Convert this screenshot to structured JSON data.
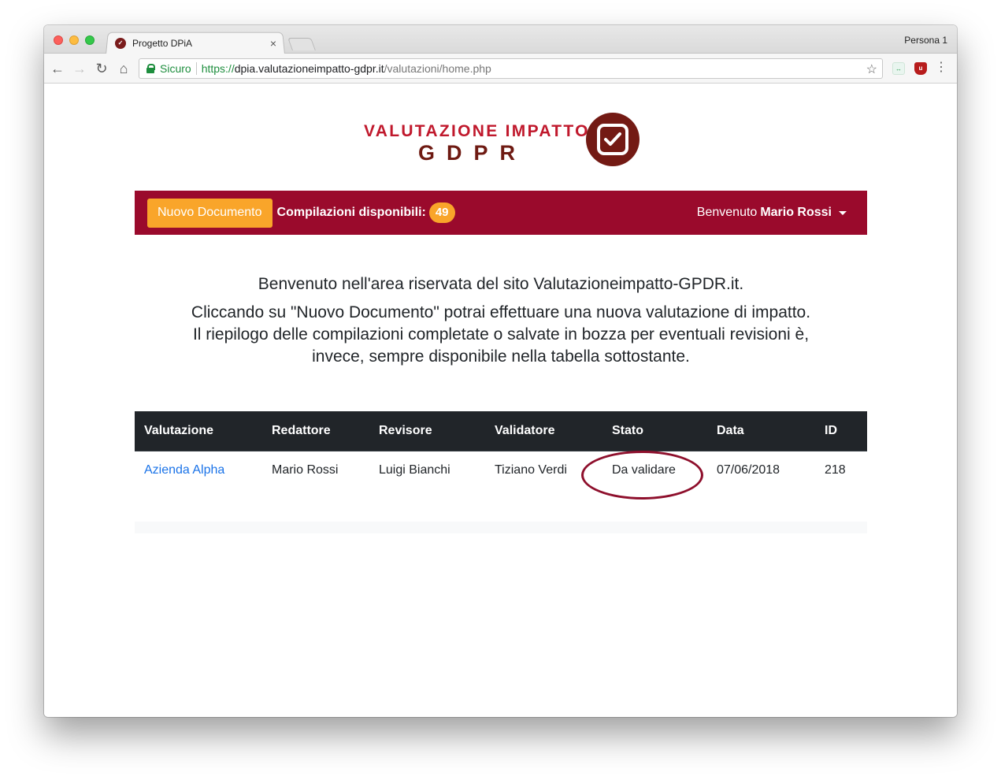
{
  "browser": {
    "tab_title": "Progetto DPiA",
    "tab_favicon": "check-badge-icon",
    "profile_label": "Persona 1",
    "secure_label": "Sicuro",
    "url_scheme": "https://",
    "url_host": "dpia.valutazioneimpatto-gdpr.it",
    "url_path": "/valutazioni/home.php",
    "icons": {
      "back": "arrow-left-icon",
      "forward": "arrow-right-icon",
      "reload": "reload-icon",
      "home": "home-icon",
      "bookmark": "star-icon",
      "menu": "kebab-menu-icon"
    }
  },
  "logo": {
    "line1": "VALUTAZIONE IMPATTO",
    "line2": "GDPR",
    "colors": {
      "red": "#c0182c",
      "dark": "#6e1a12",
      "badge": "#731a14"
    }
  },
  "navbar": {
    "new_document_label": "Nuovo Documento",
    "available_label": "Compilazioni disponibili:",
    "available_count": "49",
    "welcome_prefix": "Benvenuto",
    "user_name": "Mario Rossi",
    "colors": {
      "bar": "#9a0a2c",
      "accent": "#f9a52a"
    }
  },
  "intro": {
    "line1": "Benvenuto nell'area riservata del sito Valutazioneimpatto-GPDR.it.",
    "line2": "Cliccando su \"Nuovo Documento\" potrai effettuare una nuova valutazione di impatto.",
    "line3": "Il riepilogo delle compilazioni completate o salvate in bozza per eventuali revisioni è,",
    "line4": "invece, sempre disponibile nella tabella sottostante."
  },
  "table": {
    "headers": [
      "Valutazione",
      "Redattore",
      "Revisore",
      "Validatore",
      "Stato",
      "Data",
      "ID"
    ],
    "rows": [
      {
        "valutazione": "Azienda Alpha",
        "redattore": "Mario Rossi",
        "revisore": "Luigi Bianchi",
        "validatore": "Tiziano Verdi",
        "stato": "Da validare",
        "data": "07/06/2018",
        "id": "218"
      }
    ]
  }
}
